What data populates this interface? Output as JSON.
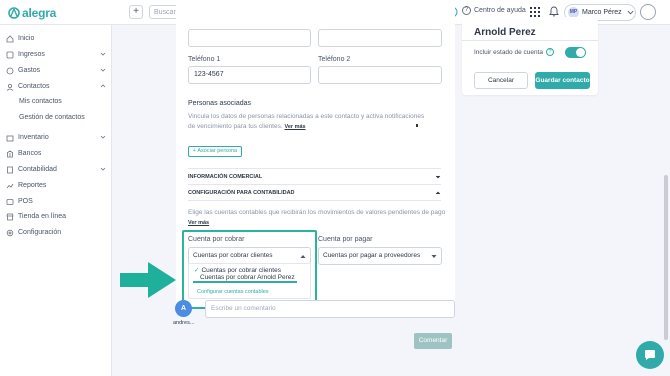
{
  "topbar": {
    "logo_text": "alegra",
    "add_label": "+",
    "search_placeholder": "Buscar...",
    "help_label": "Centro de ayuda",
    "user_initials": "MP",
    "user_name": "Marco Pérez"
  },
  "sidebar": {
    "items": [
      {
        "label": "Inicio",
        "icon": "home-icon"
      },
      {
        "label": "Ingresos",
        "icon": "income-icon"
      },
      {
        "label": "Gastos",
        "icon": "expenses-icon"
      },
      {
        "label": "Contactos",
        "icon": "contacts-icon"
      },
      {
        "label": "Inventario",
        "icon": "inventory-icon"
      },
      {
        "label": "Bancos",
        "icon": "bank-icon"
      },
      {
        "label": "Contabilidad",
        "icon": "accounting-icon"
      },
      {
        "label": "Reportes",
        "icon": "reports-icon"
      },
      {
        "label": "POS",
        "icon": "pos-icon"
      },
      {
        "label": "Tienda en línea",
        "icon": "store-icon"
      },
      {
        "label": "Configuración",
        "icon": "settings-icon"
      }
    ],
    "contact_subitems": [
      "Mis contactos",
      "Gestión de contactos"
    ]
  },
  "form": {
    "phone1_label": "Teléfono 1",
    "phone1_value": "123-4567",
    "phone2_label": "Teléfono 2",
    "phone2_value": "",
    "associated_title": "Personas asociadas",
    "associated_desc": "Vincula los datos de personas relacionadas a este contacto y activa notificaciones de vencimiento para tus clientes.",
    "see_more": "Ver más",
    "add_person": "+ Asociar persona",
    "commercial_info": "INFORMACIÓN COMERCIAL",
    "accounting_config": "CONFIGURACIÓN PARA CONTABILIDAD",
    "accounting_desc": "Elige las cuentas contables que recibirán los movimientos de valores pendientes de pago",
    "receivable_label": "Cuenta por cobrar",
    "receivable_value": "Cuentas por cobrar clientes",
    "payable_label": "Cuenta por pagar",
    "payable_value": "Cuentas por pagar a proveedores",
    "dropdown_options": [
      "Cuentas por cobrar clientes",
      "Cuentas por cobrar Arnold Perez"
    ],
    "dropdown_config": "Configurar cuentas contables"
  },
  "comment": {
    "avatar_letter": "A",
    "user": "andres...",
    "placeholder": "Escribe un comentario",
    "button": "Comentar"
  },
  "card": {
    "title": "Arnold Perez",
    "include_label": "Incluir estado de cuenta",
    "toggle_on": true,
    "cancel": "Cancelar",
    "save": "Guardar contacto"
  },
  "colors": {
    "brand": "#30aba9",
    "highlight": "#2bb3a2",
    "arrow": "#1fb09b"
  }
}
